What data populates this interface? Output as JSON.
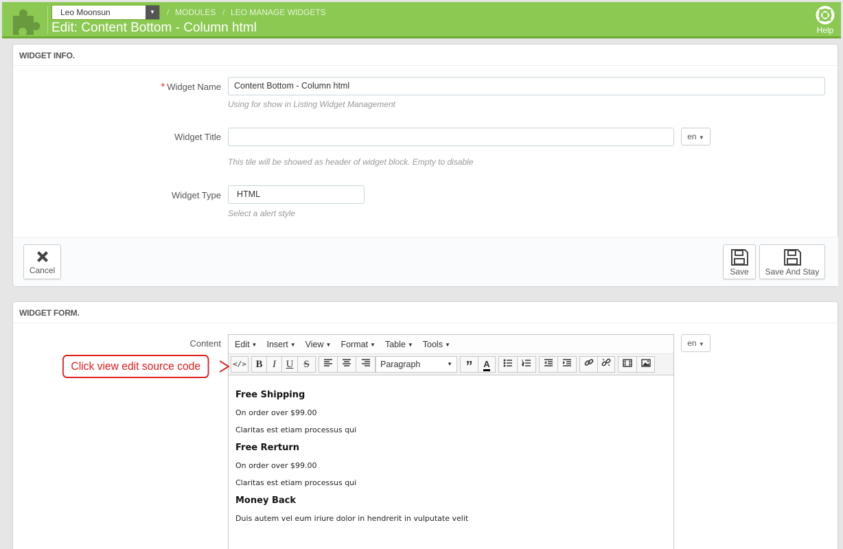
{
  "header": {
    "shop_select": "Leo Moonsun",
    "breadcrumbs": [
      "Modules",
      "Leo Manage Widgets"
    ],
    "title": "Edit: Content Bottom - Column html",
    "help_label": "Help"
  },
  "widget_info": {
    "title": "Widget info.",
    "name_label": "Widget Name",
    "name_value": "Content Bottom - Column html",
    "name_hint": "Using for show in Listing Widget Management",
    "title_label": "Widget Title",
    "title_value": "",
    "title_hint": "This tile will be showed as header of widget block. Empty to disable",
    "lang": "en",
    "type_label": "Widget Type",
    "type_value": "HTML",
    "type_hint": "Select a alert style",
    "cancel_label": "Cancel",
    "save_label": "Save",
    "save_stay_label": "Save And Stay"
  },
  "widget_form": {
    "title": "Widget form.",
    "content_label": "Content",
    "lang": "en",
    "menus": [
      "Edit",
      "Insert",
      "View",
      "Format",
      "Table",
      "Tools"
    ],
    "format_select": "Paragraph",
    "content": [
      {
        "heading": "Free Shipping",
        "lines": [
          "On order over $99.00",
          "Claritas est etiam processus qui"
        ]
      },
      {
        "heading": "Free Rerturn",
        "lines": [
          "On order over $99.00",
          "Claritas est etiam processus qui"
        ]
      },
      {
        "heading": "Money Back",
        "lines": [
          "Duis autem vel eum iriure dolor in hendrerit in vulputate velit"
        ]
      }
    ]
  },
  "callout": {
    "text": "Click view edit source code",
    "color": "#e02020"
  },
  "colors": {
    "header_green": "#8bc952",
    "required": "#e33333"
  }
}
